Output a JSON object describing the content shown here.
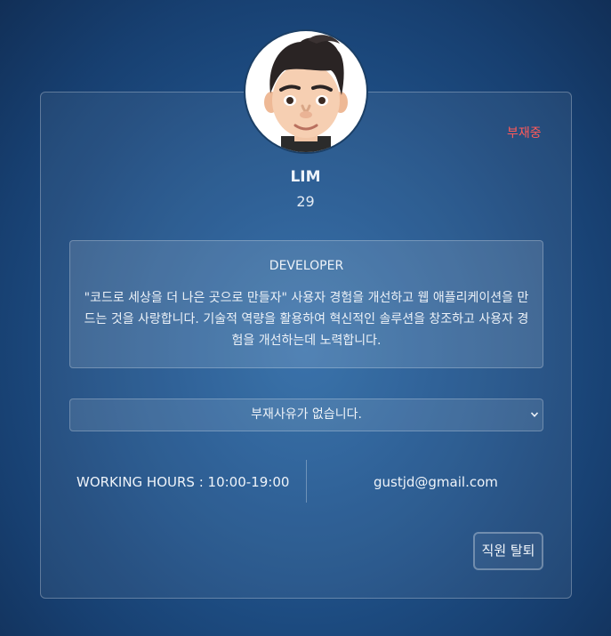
{
  "profile": {
    "status": "부재중",
    "status_color": "#ff5a5a",
    "name": "LIM",
    "age": "29",
    "avatar_icon": "memoji-avatar"
  },
  "intro": {
    "role": "DEVELOPER",
    "bio": "\"코드로 세상을 더 나은 곳으로 만들자\" 사용자 경험을 개선하고 웹 애플리케이션을 만드는 것을 사랑합니다. 기술적 역량을 활용하여 혁신적인 솔루션을 창조하고 사용자 경험을 개선하는데 노력합니다."
  },
  "absence_select": {
    "selected": "부재사유가 없습니다."
  },
  "info": {
    "working_hours": "WORKING HOURS : 10:00-19:00",
    "email": "gustjd@gmail.com"
  },
  "actions": {
    "leave_button": "직원 탈퇴"
  }
}
